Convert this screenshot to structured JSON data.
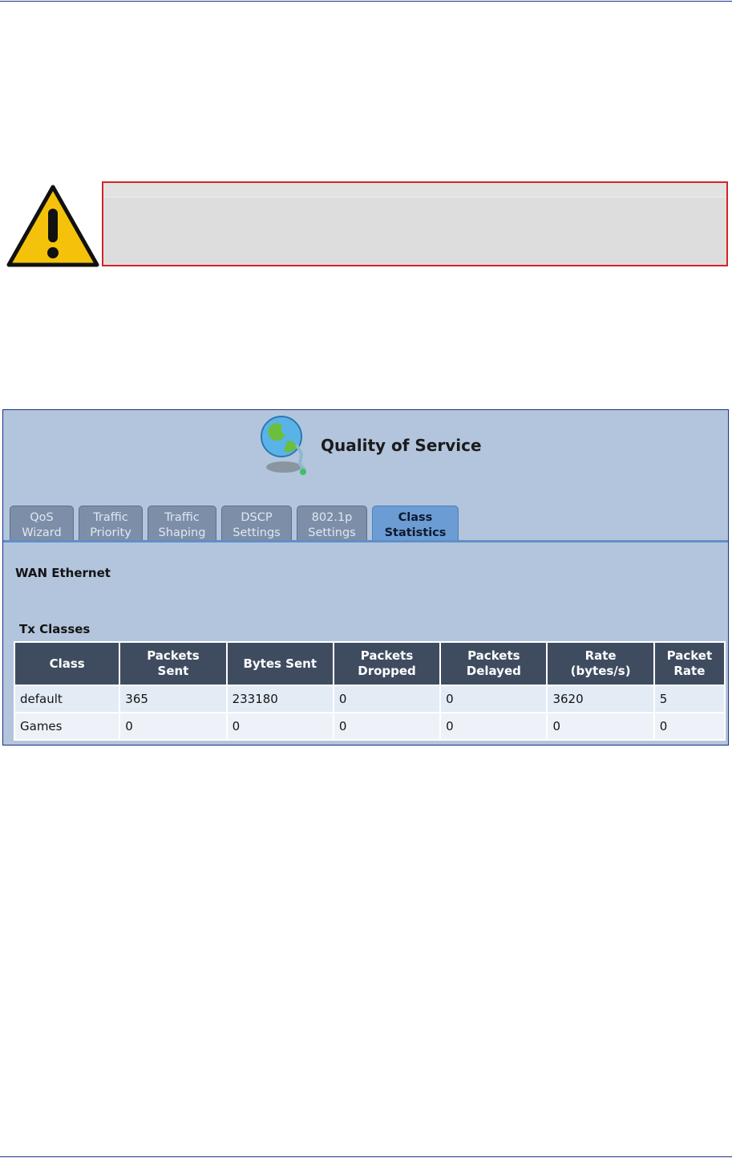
{
  "qos": {
    "title": "Quality of Service",
    "tabs": [
      {
        "line1": "QoS",
        "line2": "Wizard"
      },
      {
        "line1": "Traffic",
        "line2": "Priority"
      },
      {
        "line1": "Traffic",
        "line2": "Shaping"
      },
      {
        "line1": "DSCP",
        "line2": "Settings"
      },
      {
        "line1": "802.1p",
        "line2": "Settings"
      },
      {
        "line1": "Class",
        "line2": "Statistics"
      }
    ],
    "active_tab": "Class Statistics",
    "section_title": "WAN Ethernet",
    "table_title": "Tx Classes",
    "table": {
      "headers": [
        [
          "Class",
          ""
        ],
        [
          "Packets",
          "Sent"
        ],
        [
          "Bytes Sent",
          ""
        ],
        [
          "Packets",
          "Dropped"
        ],
        [
          "Packets",
          "Delayed"
        ],
        [
          "Rate",
          "(bytes/s)"
        ],
        [
          "Packet",
          "Rate"
        ]
      ],
      "rows": [
        [
          "default",
          "365",
          "233180",
          "0",
          "0",
          "3620",
          "5"
        ],
        [
          "Games",
          "0",
          "0",
          "0",
          "0",
          "0",
          "0"
        ]
      ]
    }
  },
  "colors": {
    "frame_bg": "#b3c5dc",
    "header_bg": "#3f4c60",
    "active_tab": "#6b9cd3",
    "warning_border": "#d4242a",
    "rule": "#1f2e8c"
  }
}
